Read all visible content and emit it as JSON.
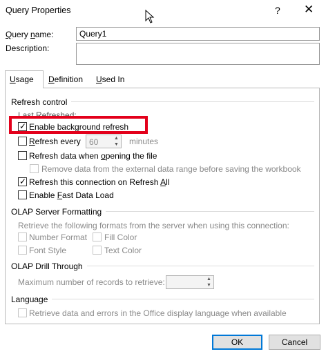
{
  "window": {
    "title": "Query Properties",
    "help_glyph": "?",
    "close_glyph": "✕"
  },
  "fields": {
    "query_name_label": "Query name:",
    "query_name_value": "Query1",
    "description_label": "Description:",
    "description_value": ""
  },
  "tabs": [
    {
      "label": "Usage",
      "active": true
    },
    {
      "label": "Definition",
      "active": false
    },
    {
      "label": "Used In",
      "active": false
    }
  ],
  "usage": {
    "refresh_control": {
      "heading": "Refresh control",
      "last_refreshed_label": "Last Refreshed:",
      "enable_background_refresh": {
        "label": "Enable background refresh",
        "checked": true
      },
      "refresh_every": {
        "label": "Refresh every",
        "checked": false,
        "value": "60",
        "unit": "minutes"
      },
      "refresh_on_open": {
        "label": "Refresh data when opening the file",
        "checked": false
      },
      "remove_data": {
        "label": "Remove data from the external data range before saving the workbook",
        "checked": false,
        "enabled": false
      },
      "refresh_all": {
        "label": "Refresh this connection on Refresh All",
        "checked": true
      },
      "fast_load": {
        "label": "Enable Fast Data Load",
        "checked": false
      }
    },
    "olap_formatting": {
      "heading": "OLAP Server Formatting",
      "description": "Retrieve the following formats from the server when using this connection:",
      "number_format": "Number Format",
      "fill_color": "Fill Color",
      "font_style": "Font Style",
      "text_color": "Text Color"
    },
    "olap_drill": {
      "heading": "OLAP Drill Through",
      "max_records_label": "Maximum number of records to retrieve:",
      "max_records_value": ""
    },
    "language": {
      "heading": "Language",
      "retrieve_label": "Retrieve data and errors in the Office display language when available"
    }
  },
  "buttons": {
    "ok": "OK",
    "cancel": "Cancel"
  },
  "colors": {
    "highlight_box": "#e3001b",
    "default_button_border": "#0078d7"
  }
}
